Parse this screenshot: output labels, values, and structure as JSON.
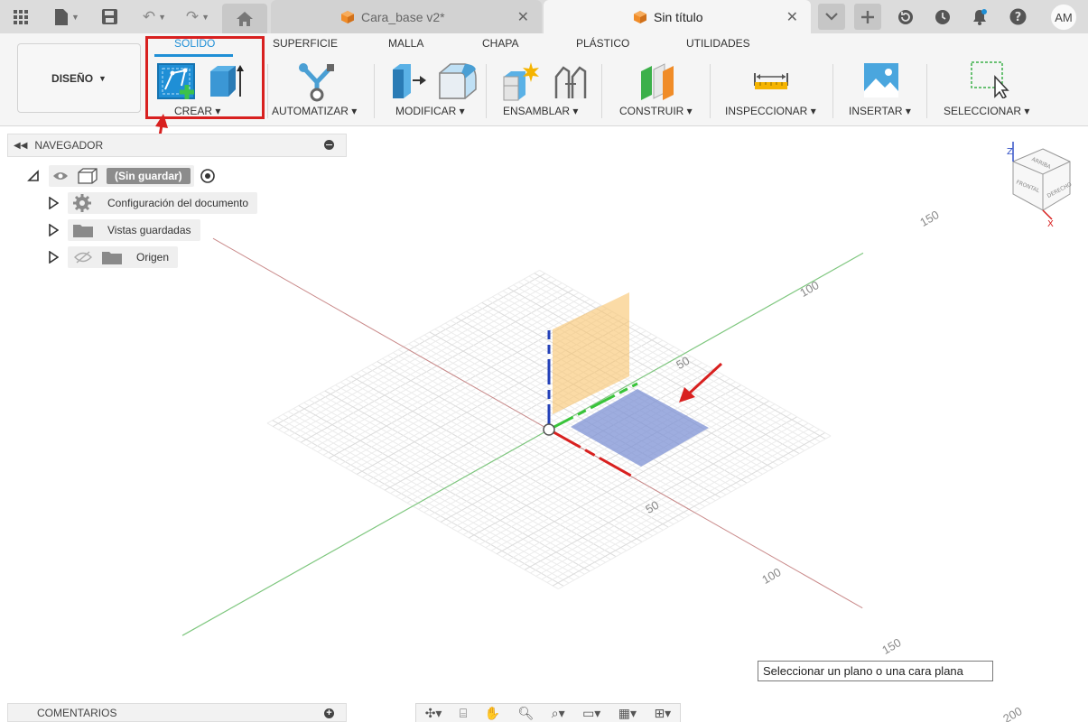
{
  "titlebar": {
    "tabs": [
      {
        "label": "Cara_base v2*",
        "active": false
      },
      {
        "label": "Sin título",
        "active": true
      }
    ],
    "user_initials": "AM",
    "icons": [
      "grid-icon",
      "file-icon",
      "save-icon",
      "undo-icon",
      "redo-icon",
      "home-icon",
      "chevron-down-icon",
      "plus-icon",
      "refresh-icon",
      "clock-icon",
      "bell-icon",
      "help-icon"
    ]
  },
  "toolbar": {
    "workspace": "DISEÑO",
    "ribbon_tabs": [
      "SÓLIDO",
      "SUPERFICIE",
      "MALLA",
      "CHAPA",
      "PLÁSTICO",
      "UTILIDADES"
    ],
    "active_tab": "SÓLIDO",
    "groups": [
      "CREAR",
      "AUTOMATIZAR",
      "MODIFICAR",
      "ENSAMBLAR",
      "CONSTRUIR",
      "INSPECCIONAR",
      "INSERTAR",
      "SELECCIONAR"
    ],
    "accent": "#1f8fd6",
    "highlight": "#d8201f"
  },
  "navigator": {
    "title": "NAVEGADOR",
    "root": "(Sin guardar)",
    "items": [
      "Configuración del documento",
      "Vistas guardadas",
      "Origen"
    ]
  },
  "viewport": {
    "ticks": [
      "150",
      "100",
      "50",
      "50",
      "100",
      "150",
      "200"
    ],
    "viewcube_axis": {
      "z": "Z",
      "x": "X"
    },
    "viewcube_faces": [
      "ARRIBA",
      "FRONTAL",
      "DERECHO"
    ]
  },
  "tooltip": "Seleccionar un plano o una cara plana",
  "bottom": {
    "comments": "COMENTARIOS"
  }
}
